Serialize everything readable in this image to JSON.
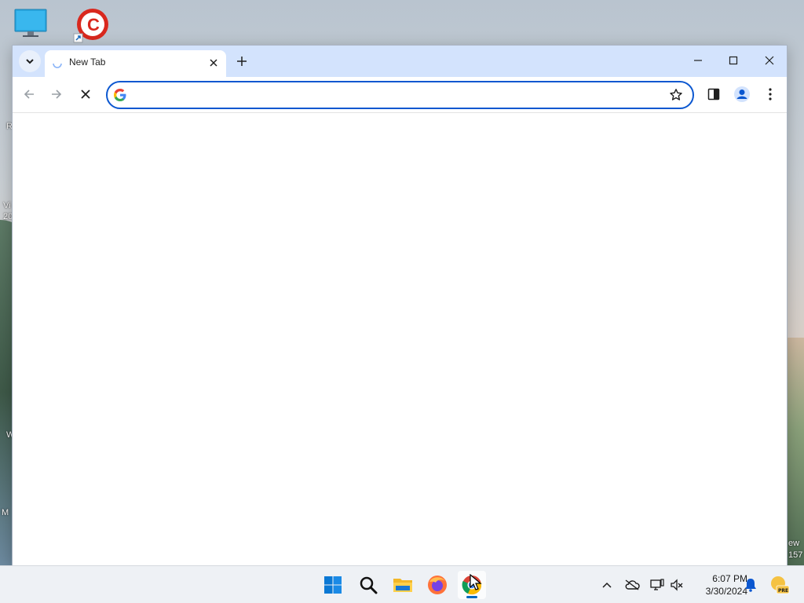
{
  "desktop": {
    "icons": [
      {
        "name": "This PC",
        "icon": "monitor-icon"
      },
      {
        "name": "CCleaner",
        "icon": "ccleaner-icon"
      }
    ],
    "edge_fragments": [
      "R",
      "Vi",
      "20",
      "W",
      "M",
      "ew",
      "157"
    ]
  },
  "browser": {
    "tab": {
      "title": "New Tab",
      "loading": true
    },
    "omnibox": {
      "value": "",
      "placeholder": ""
    },
    "colors": {
      "tabstrip": "#d3e3fd",
      "focus_ring": "#0b57d0"
    }
  },
  "taskbar": {
    "apps": [
      {
        "name": "Start",
        "icon": "windows-start-icon"
      },
      {
        "name": "Search",
        "icon": "search-icon"
      },
      {
        "name": "File Explorer",
        "icon": "folder-icon"
      },
      {
        "name": "Firefox",
        "icon": "firefox-icon"
      },
      {
        "name": "Google Chrome",
        "icon": "chrome-icon",
        "active": true
      }
    ],
    "clock": {
      "time": "6:07 PM",
      "date": "3/30/2024"
    }
  }
}
